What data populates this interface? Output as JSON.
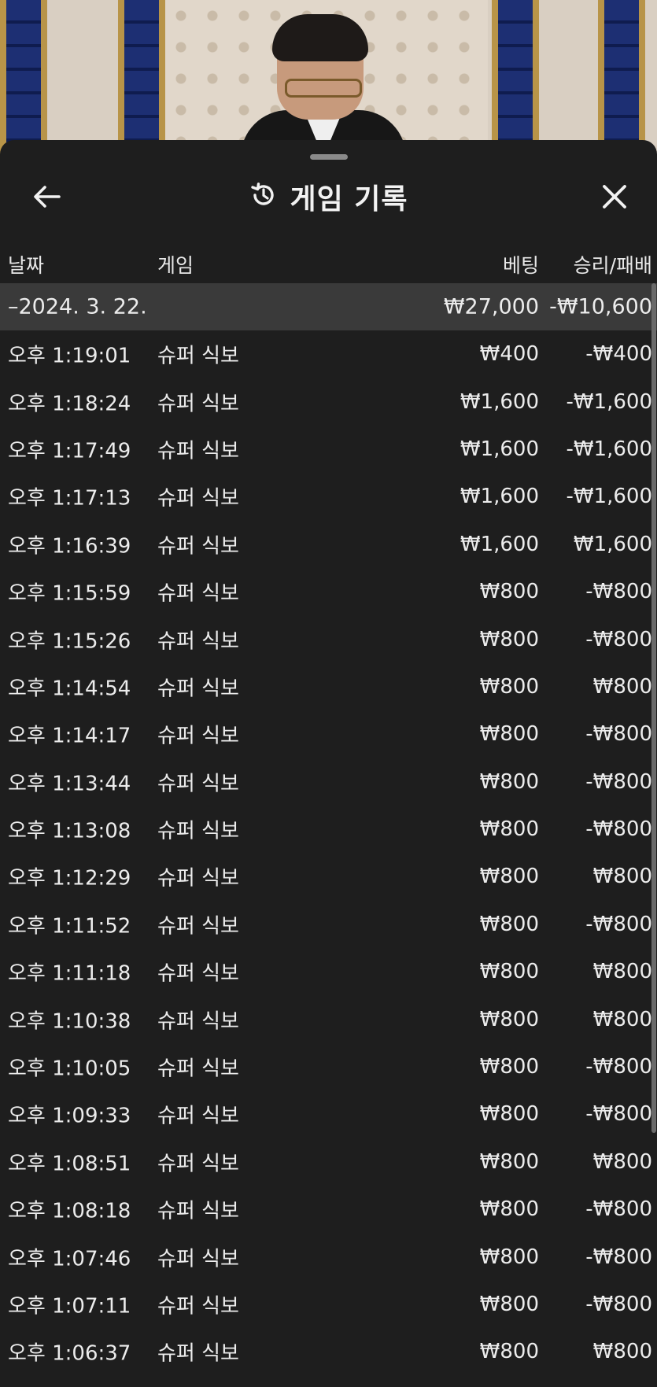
{
  "header": {
    "title": "게임 기록",
    "back_icon": "arrow-left-icon",
    "history_icon": "history-clock-icon",
    "close_icon": "close-icon"
  },
  "columns": {
    "date": "날짜",
    "game": "게임",
    "bet": "베팅",
    "win_loss": "승리/패배"
  },
  "summary": {
    "date": "–2024. 3. 22.",
    "bet": "₩27,000",
    "win_loss": "-₩10,600"
  },
  "rows": [
    {
      "time": "오후 1:19:01",
      "game": "슈퍼 식보",
      "bet": "₩400",
      "result": "-₩400"
    },
    {
      "time": "오후 1:18:24",
      "game": "슈퍼 식보",
      "bet": "₩1,600",
      "result": "-₩1,600"
    },
    {
      "time": "오후 1:17:49",
      "game": "슈퍼 식보",
      "bet": "₩1,600",
      "result": "-₩1,600"
    },
    {
      "time": "오후 1:17:13",
      "game": "슈퍼 식보",
      "bet": "₩1,600",
      "result": "-₩1,600"
    },
    {
      "time": "오후 1:16:39",
      "game": "슈퍼 식보",
      "bet": "₩1,600",
      "result": "₩1,600"
    },
    {
      "time": "오후 1:15:59",
      "game": "슈퍼 식보",
      "bet": "₩800",
      "result": "-₩800"
    },
    {
      "time": "오후 1:15:26",
      "game": "슈퍼 식보",
      "bet": "₩800",
      "result": "-₩800"
    },
    {
      "time": "오후 1:14:54",
      "game": "슈퍼 식보",
      "bet": "₩800",
      "result": "₩800"
    },
    {
      "time": "오후 1:14:17",
      "game": "슈퍼 식보",
      "bet": "₩800",
      "result": "-₩800"
    },
    {
      "time": "오후 1:13:44",
      "game": "슈퍼 식보",
      "bet": "₩800",
      "result": "-₩800"
    },
    {
      "time": "오후 1:13:08",
      "game": "슈퍼 식보",
      "bet": "₩800",
      "result": "-₩800"
    },
    {
      "time": "오후 1:12:29",
      "game": "슈퍼 식보",
      "bet": "₩800",
      "result": "₩800"
    },
    {
      "time": "오후 1:11:52",
      "game": "슈퍼 식보",
      "bet": "₩800",
      "result": "-₩800"
    },
    {
      "time": "오후 1:11:18",
      "game": "슈퍼 식보",
      "bet": "₩800",
      "result": "₩800"
    },
    {
      "time": "오후 1:10:38",
      "game": "슈퍼 식보",
      "bet": "₩800",
      "result": "₩800"
    },
    {
      "time": "오후 1:10:05",
      "game": "슈퍼 식보",
      "bet": "₩800",
      "result": "-₩800"
    },
    {
      "time": "오후 1:09:33",
      "game": "슈퍼 식보",
      "bet": "₩800",
      "result": "-₩800"
    },
    {
      "time": "오후 1:08:51",
      "game": "슈퍼 식보",
      "bet": "₩800",
      "result": "₩800"
    },
    {
      "time": "오후 1:08:18",
      "game": "슈퍼 식보",
      "bet": "₩800",
      "result": "-₩800"
    },
    {
      "time": "오후 1:07:46",
      "game": "슈퍼 식보",
      "bet": "₩800",
      "result": "-₩800"
    },
    {
      "time": "오후 1:07:11",
      "game": "슈퍼 식보",
      "bet": "₩800",
      "result": "-₩800"
    },
    {
      "time": "오후 1:06:37",
      "game": "슈퍼 식보",
      "bet": "₩800",
      "result": "₩800"
    }
  ]
}
